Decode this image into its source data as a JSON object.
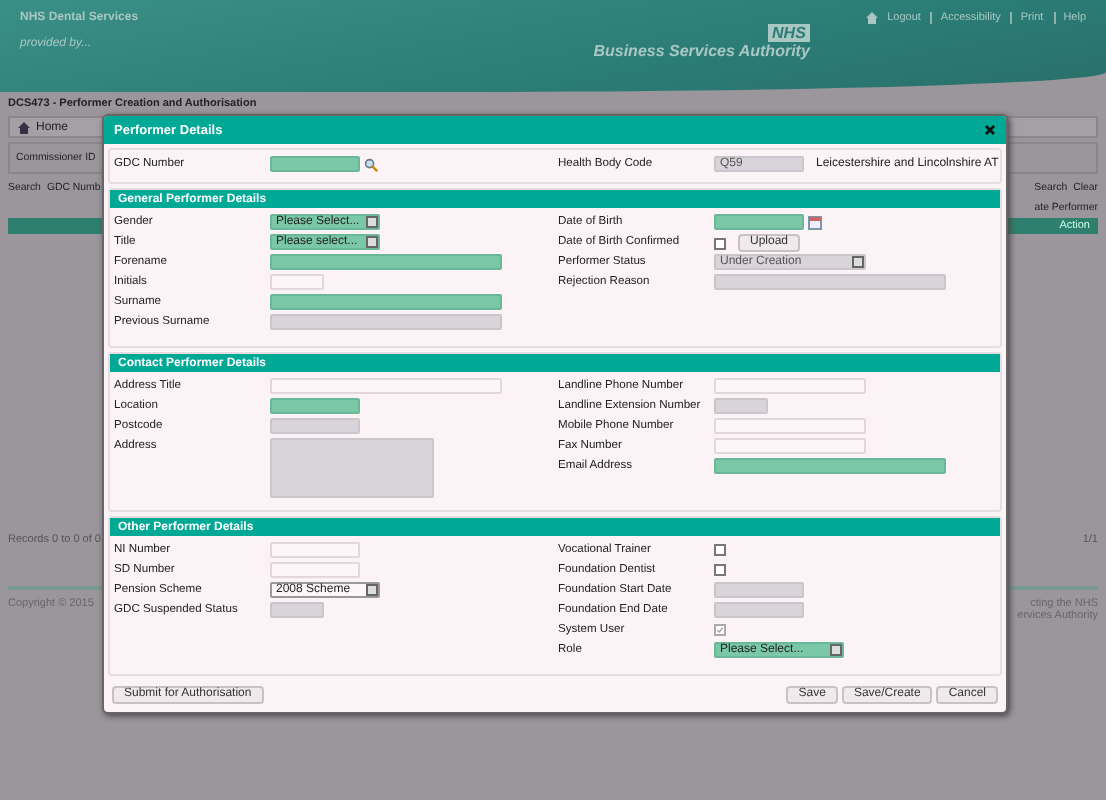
{
  "page": {
    "header": {
      "service": "NHS Dental Services",
      "provided_by": "provided by...",
      "logo": "NHS",
      "authority": "Business Services Authority",
      "links": [
        "Logout",
        "Accessibility",
        "Print",
        "Help"
      ]
    },
    "title": "DCS473 - Performer Creation and Authorisation",
    "breadcrumb": "Home",
    "commissioner_label": "Commissioner ID",
    "search_left": [
      "Search",
      "GDC Numb"
    ],
    "search_buttons": [
      "Search",
      "Clear"
    ],
    "create_label": "ate Performer",
    "action_header": "Action",
    "records": "Records 0 to 0 of 0",
    "pager": "1/1",
    "copyright": "Copyright © 2015",
    "footer_right": [
      "cting the NHS",
      "ervices Authority"
    ]
  },
  "dialog": {
    "title": "Performer Details",
    "top": {
      "left": [
        {
          "label": "GDC Number",
          "kind": "search",
          "required": true,
          "disabled": false
        }
      ],
      "right": [
        {
          "label": "Health Body Code",
          "kind": "text",
          "disabled": true,
          "value": "Q59",
          "note": "Leicestershire and Lincolnshire AT"
        }
      ]
    },
    "sections": [
      {
        "title": "General Performer Details",
        "left": [
          {
            "label": "Gender",
            "kind": "select",
            "required": true,
            "disabled": false,
            "value": "Please Select..."
          },
          {
            "label": "Title",
            "kind": "select",
            "required": true,
            "disabled": false,
            "value": "Please select..."
          },
          {
            "label": "Forename",
            "kind": "text",
            "required": true,
            "disabled": false
          },
          {
            "label": "Initials",
            "kind": "text",
            "required": false,
            "disabled": false
          },
          {
            "label": "Surname",
            "kind": "text",
            "required": true,
            "disabled": false
          },
          {
            "label": "Previous Surname",
            "kind": "text",
            "required": false,
            "disabled": true
          }
        ],
        "right": [
          {
            "label": "Date of Birth",
            "kind": "date",
            "required": true,
            "disabled": false
          },
          {
            "label": "Date of Birth Confirmed",
            "kind": "checkbox",
            "checked": false,
            "disabled": false,
            "button": "Upload"
          },
          {
            "label": "Performer Status",
            "kind": "select",
            "required": false,
            "disabled": true,
            "value": "Under Creation"
          },
          {
            "label": "Rejection Reason",
            "kind": "text",
            "required": false,
            "disabled": true
          }
        ]
      },
      {
        "title": "Contact Performer Details",
        "left": [
          {
            "label": "Address Title",
            "kind": "text",
            "required": false,
            "disabled": false
          },
          {
            "label": "Location",
            "kind": "text",
            "required": true,
            "disabled": false
          },
          {
            "label": "Postcode",
            "kind": "text",
            "required": false,
            "disabled": true
          },
          {
            "label": "Address",
            "kind": "textarea",
            "required": false,
            "disabled": true
          }
        ],
        "right": [
          {
            "label": "Landline Phone Number",
            "kind": "text",
            "required": false,
            "disabled": false
          },
          {
            "label": "Landline Extension Number",
            "kind": "text",
            "required": false,
            "disabled": true
          },
          {
            "label": "Mobile Phone Number",
            "kind": "text",
            "required": false,
            "disabled": false
          },
          {
            "label": "Fax Number",
            "kind": "text",
            "required": false,
            "disabled": false
          },
          {
            "label": "Email Address",
            "kind": "text",
            "required": true,
            "disabled": false
          }
        ]
      },
      {
        "title": "Other Performer Details",
        "left": [
          {
            "label": "NI Number",
            "kind": "text",
            "required": false,
            "disabled": false
          },
          {
            "label": "SD Number",
            "kind": "text",
            "required": false,
            "disabled": false
          },
          {
            "label": "Pension Scheme",
            "kind": "select",
            "required": false,
            "disabled": false,
            "value": "2008 Scheme"
          },
          {
            "label": "GDC Suspended Status",
            "kind": "text",
            "required": false,
            "disabled": true
          }
        ],
        "right": [
          {
            "label": "Vocational Trainer",
            "kind": "checkbox",
            "checked": false,
            "disabled": false
          },
          {
            "label": "Foundation Dentist",
            "kind": "checkbox",
            "checked": false,
            "disabled": false
          },
          {
            "label": "Foundation Start Date",
            "kind": "text",
            "required": false,
            "disabled": true
          },
          {
            "label": "Foundation End Date",
            "kind": "text",
            "required": false,
            "disabled": true
          },
          {
            "label": "System User",
            "kind": "checkbox",
            "checked": true,
            "disabled": true
          },
          {
            "label": "Role",
            "kind": "select",
            "required": true,
            "disabled": false,
            "value": "Please Select..."
          }
        ]
      }
    ],
    "left_button": "Submit for Authorisation",
    "buttons": [
      "Save",
      "Save/Create",
      "Cancel"
    ]
  }
}
